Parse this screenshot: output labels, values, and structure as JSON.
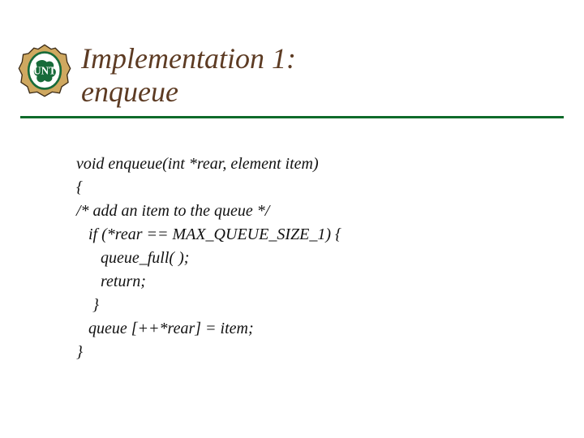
{
  "header": {
    "title_line1": "Implementation 1:",
    "title_line2": "enqueue",
    "logo_alt": "UNT logo"
  },
  "colors": {
    "title": "#5d3b23",
    "rule": "#0f6b2a",
    "unt_green": "#176b3a",
    "unt_beige": "#cfa860"
  },
  "code": {
    "l1": "void enqueue(int *rear, element item)",
    "l2": "{",
    "l3": "/* add an item to the queue */",
    "l4": "   if (*rear == MAX_QUEUE_SIZE_1) {",
    "l5": "      queue_full( );",
    "l6": "      return;",
    "l7": "    }",
    "l8": "   queue [++*rear] = item;",
    "l9": "}"
  }
}
